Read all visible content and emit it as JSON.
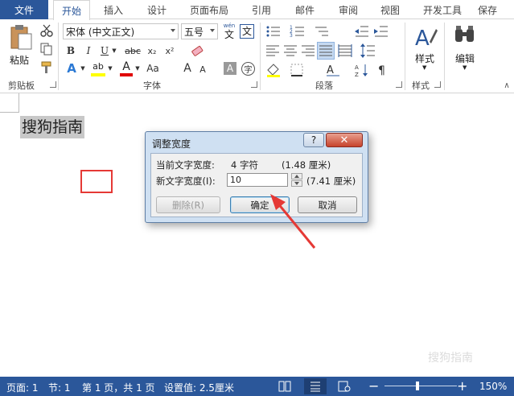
{
  "tabs": {
    "file": "文件",
    "items": [
      "开始",
      "插入",
      "设计",
      "页面布局",
      "引用",
      "邮件",
      "审阅",
      "视图",
      "开发工具",
      "保存"
    ],
    "active_index": 0
  },
  "ribbon": {
    "clipboard": {
      "paste_label": "粘贴",
      "group_label": "剪贴板"
    },
    "font": {
      "font_name": "宋体 (中文正文)",
      "font_size": "五号",
      "wen_label": "wén",
      "wen_char": "文",
      "bold": "B",
      "italic": "I",
      "underline": "U",
      "strike": "abc",
      "subscript": "x₂",
      "superscript": "x²",
      "text_effect": "A",
      "highlight": "ab",
      "font_color": "A",
      "case": "Aa",
      "grow": "A",
      "shrink": "A",
      "char_shading": "A",
      "enclose": "字",
      "group_label": "字体"
    },
    "paragraph": {
      "group_label": "段落"
    },
    "styles": {
      "label": "样式",
      "group_label": "样式"
    },
    "editing": {
      "label": "编辑"
    }
  },
  "document": {
    "text": "搜狗指南",
    "watermark": "搜狗指南"
  },
  "dialog": {
    "title": "调整宽度",
    "help": "?",
    "close": "✕",
    "current_label": "当前文字宽度:",
    "current_value": "4 字符",
    "current_cm": "(1.48 厘米)",
    "new_label": "新文字宽度(I):",
    "new_value": "10",
    "new_cm": "(7.41 厘米)",
    "delete_btn": "删除(R)",
    "ok_btn": "确定",
    "cancel_btn": "取消"
  },
  "status": {
    "page": "页面: 1",
    "section": "节: 1",
    "page_of": "第 1 页，共 1 页",
    "setting": "设置值: 2.5厘米",
    "zoom": "150%"
  },
  "colors": {
    "accent": "#2b579a",
    "highlight_yellow": "#ffff00",
    "font_red": "#e00000",
    "annotation_red": "#e53935"
  }
}
